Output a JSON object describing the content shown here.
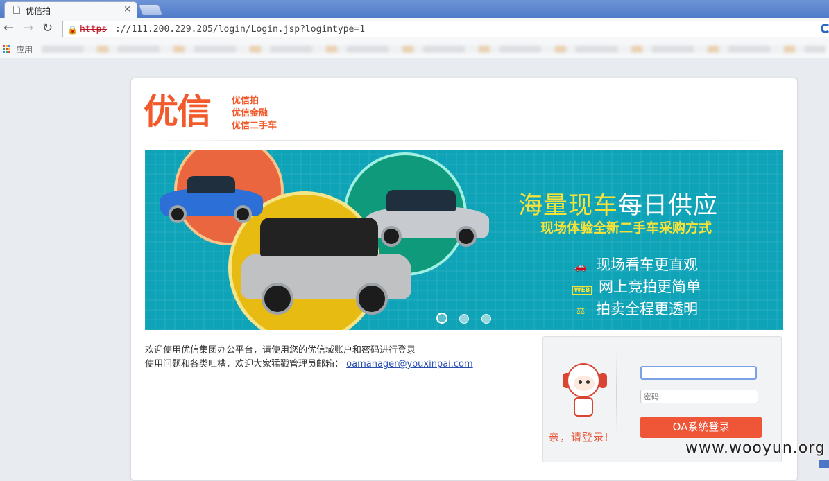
{
  "browser": {
    "tab_title": "优信拍",
    "tab_close": "×",
    "back_icon": "back-arrow-icon",
    "forward_icon": "forward-arrow-icon",
    "reload_icon": "reload-icon",
    "url_scheme": "https",
    "url_rest": "://111.200.229.205/login/Login.jsp?logintype=1",
    "bookmarks_apps_label": "应用"
  },
  "logo": {
    "main": "优信",
    "lines": [
      "优信拍",
      "优信金融",
      "优信二手车"
    ]
  },
  "banner": {
    "headline_highlight": "海量现车",
    "headline_rest": "每日供应",
    "subline": "现场体验全新二手车采购方式",
    "features": [
      {
        "icon_text": "🚗",
        "icon": "car-icon",
        "label": "现场看车更直观"
      },
      {
        "icon_text": "WEB",
        "icon": "web-icon",
        "label": "网上竞拍更简单"
      },
      {
        "icon_text": "⚖",
        "icon": "scale-icon",
        "label": "拍卖全程更透明"
      }
    ],
    "slide_active": "1",
    "slide_count": 3
  },
  "welcome": {
    "line1": "欢迎使用优信集团办公平台，请使用您的优信域账户和密码进行登录",
    "line2": "使用问题和各类吐槽，欢迎大家猛戳管理员邮箱：",
    "email": "oamanager@youxinpai.com"
  },
  "login": {
    "greeting": "亲，请登录!",
    "username_value": "",
    "password_placeholder": "密码:",
    "submit_label": "OA系统登录"
  },
  "watermark": "www.wooyun.org",
  "colors": {
    "brand": "#f25a2c",
    "banner_bg": "#0fa3b8",
    "highlight_yellow": "#f7e237",
    "button": "#ef5537"
  }
}
